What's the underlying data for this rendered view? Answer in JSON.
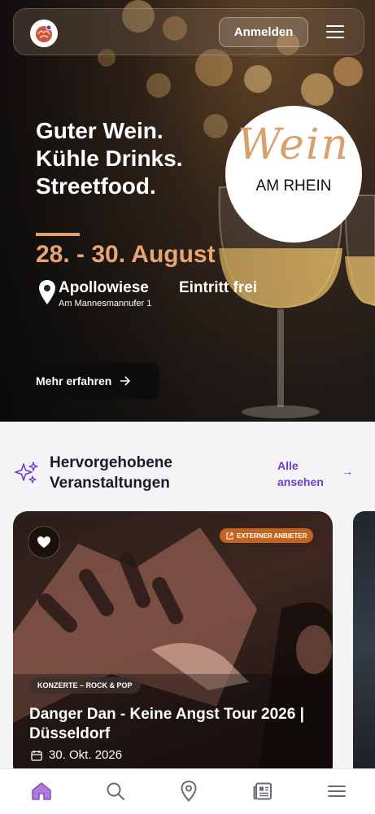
{
  "header": {
    "login_label": "Anmelden",
    "icons": [
      "brain-logo-icon",
      "hamburger-menu-icon"
    ]
  },
  "hero": {
    "headline": [
      "Guter Wein.",
      "Kühle Drinks.",
      "Streetfood."
    ],
    "badge_script": "Wein",
    "badge_sub": "AM RHEIN",
    "date": "28. - 30. August",
    "location_name": "Apollowiese",
    "location_sub": "Am Mannesmannufer 1",
    "entry": "Eintritt frei",
    "cta_label": "Mehr erfahren",
    "accent_color": "#e8a473"
  },
  "section": {
    "title_line1": "Hervorgehobene",
    "title_line2": "Veranstaltungen",
    "see_all_line1": "Alle",
    "see_all_line2": "ansehen",
    "link_color": "#6a3fc9"
  },
  "card": {
    "ext_tag": "EXTERNER ANBIETER",
    "category": "KONZERTE – ROCK & POP",
    "title": "Danger Dan - Keine Angst Tour 2026 | Düsseldorf",
    "date": "30. Okt. 2026",
    "tag_color": "#c4651f"
  },
  "bottom_nav": {
    "items": [
      "home-icon",
      "search-icon",
      "map-pin-icon",
      "news-icon",
      "menu-icon"
    ],
    "active_color": "#8a4fc9"
  }
}
